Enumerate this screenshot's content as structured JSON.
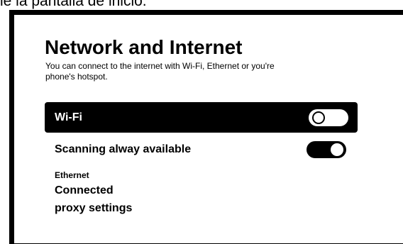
{
  "caption": "le la pantalla de inicio.",
  "page": {
    "title": "Network and Internet",
    "subtitle": "You can connect to the internet with Wi-Fi, Ethernet or you're phone's hotspot."
  },
  "settings": {
    "wifi": {
      "label": "Wi-Fi",
      "enabled": false
    },
    "scanning": {
      "label": "Scanning alway available",
      "enabled": true
    }
  },
  "ethernet": {
    "heading": "Ethernet",
    "status": "Connected",
    "proxy_label": "proxy settings"
  },
  "colors": {
    "background": "#ffffff",
    "frame": "#000000",
    "selected_row": "#000000"
  }
}
